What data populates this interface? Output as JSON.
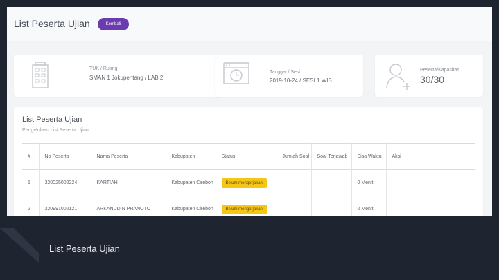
{
  "header": {
    "title": "List Peserta Ujian",
    "back_label": "Kembali"
  },
  "stats": {
    "room": {
      "label": "TUK / Ruang",
      "value": "SMAN 1 Jokupentang / LAB 2",
      "icon": "building-icon"
    },
    "session": {
      "label": "Tanggal / Sesi",
      "value": "2019-10-24 / SESI 1 WIB",
      "icon": "calendar-clock-icon"
    },
    "participants": {
      "label": "Peserta/Kapasitas",
      "value": "30/30",
      "icon": "add-user-icon"
    }
  },
  "main": {
    "title": "List Peserta Ujian",
    "subtitle": "Pengelolaan List Peserta Ujian",
    "columns": [
      "#",
      "No Peserta",
      "Nama Peserta",
      "Kabupaten",
      "Status",
      "Jumlah Soal",
      "Soal Terjawab",
      "Sisa Waktu",
      "Aksi"
    ],
    "rows": [
      {
        "no": "1",
        "no_peserta": "320025002224",
        "nama": "KARTIAH",
        "kabupaten": "Kabupaten Cirebon",
        "status": "Belum mengerjakan",
        "jumlah_soal": "",
        "soal_terjawab": "",
        "sisa_waktu": "0 Menit",
        "aksi": ""
      },
      {
        "no": "2",
        "no_peserta": "320991002121",
        "nama": "ARKANUDIN PRANOTO",
        "kabupaten": "Kabupaten Cirebon",
        "status": "Belum mengerjakan",
        "jumlah_soal": "",
        "soal_terjawab": "",
        "sisa_waktu": "0 Menit",
        "aksi": ""
      }
    ]
  },
  "footer": {
    "slide_title": "List Peserta Ujian"
  },
  "colors": {
    "accent": "#6a3cad",
    "badge": "#f5c518",
    "background_dark": "#1e2430"
  }
}
